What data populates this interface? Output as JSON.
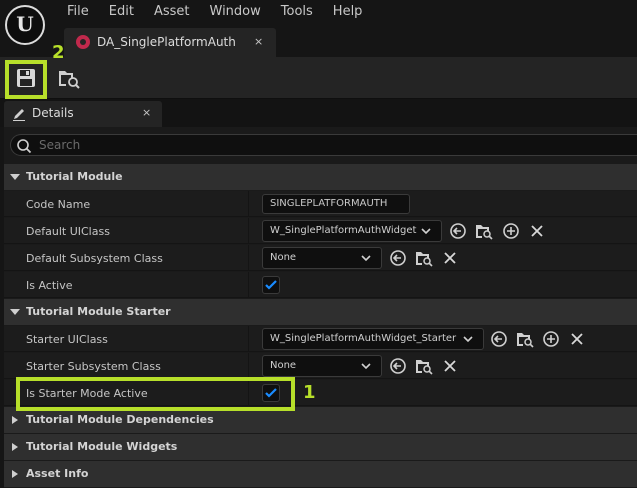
{
  "app": {
    "menu": [
      "File",
      "Edit",
      "Asset",
      "Window",
      "Tools",
      "Help"
    ]
  },
  "document_tab": {
    "title": "DA_SinglePlatformAuth",
    "close_glyph": "×",
    "icon": "data-asset-icon",
    "icon_color": "#c0294c"
  },
  "toolbar": {
    "buttons": [
      "save-icon",
      "browse-to-asset-icon"
    ]
  },
  "details_panel": {
    "tab_label": "Details",
    "close_glyph": "×",
    "search": {
      "placeholder": "Search",
      "value": ""
    }
  },
  "categories": {
    "tutorial_module": {
      "label": "Tutorial Module",
      "expanded": true,
      "code_name": {
        "label": "Code Name",
        "value": "SINGLEPLATFORMAUTH"
      },
      "default_ui_class": {
        "label": "Default UIClass",
        "value": "W_SinglePlatformAuthWidget"
      },
      "default_subsystem_class": {
        "label": "Default Subsystem Class",
        "value": "None"
      },
      "is_active": {
        "label": "Is Active",
        "checked": true
      }
    },
    "tutorial_module_starter": {
      "label": "Tutorial Module Starter",
      "expanded": true,
      "starter_ui_class": {
        "label": "Starter UIClass",
        "value": "W_SinglePlatformAuthWidget_Starter"
      },
      "starter_subsystem_class": {
        "label": "Starter Subsystem Class",
        "value": "None"
      },
      "is_starter_mode_active": {
        "label": "Is Starter Mode Active",
        "checked": true
      }
    },
    "tutorial_module_dependencies": {
      "label": "Tutorial Module Dependencies",
      "expanded": false
    },
    "tutorial_module_widgets": {
      "label": "Tutorial Module Widgets",
      "expanded": false
    },
    "asset_info": {
      "label": "Asset Info",
      "expanded": false
    }
  },
  "annotations": {
    "callout_1": "1",
    "callout_2": "2",
    "highlight_color": "#b7df2a"
  },
  "colors": {
    "checkbox_check": "#1a8cff",
    "background": "#151515"
  }
}
